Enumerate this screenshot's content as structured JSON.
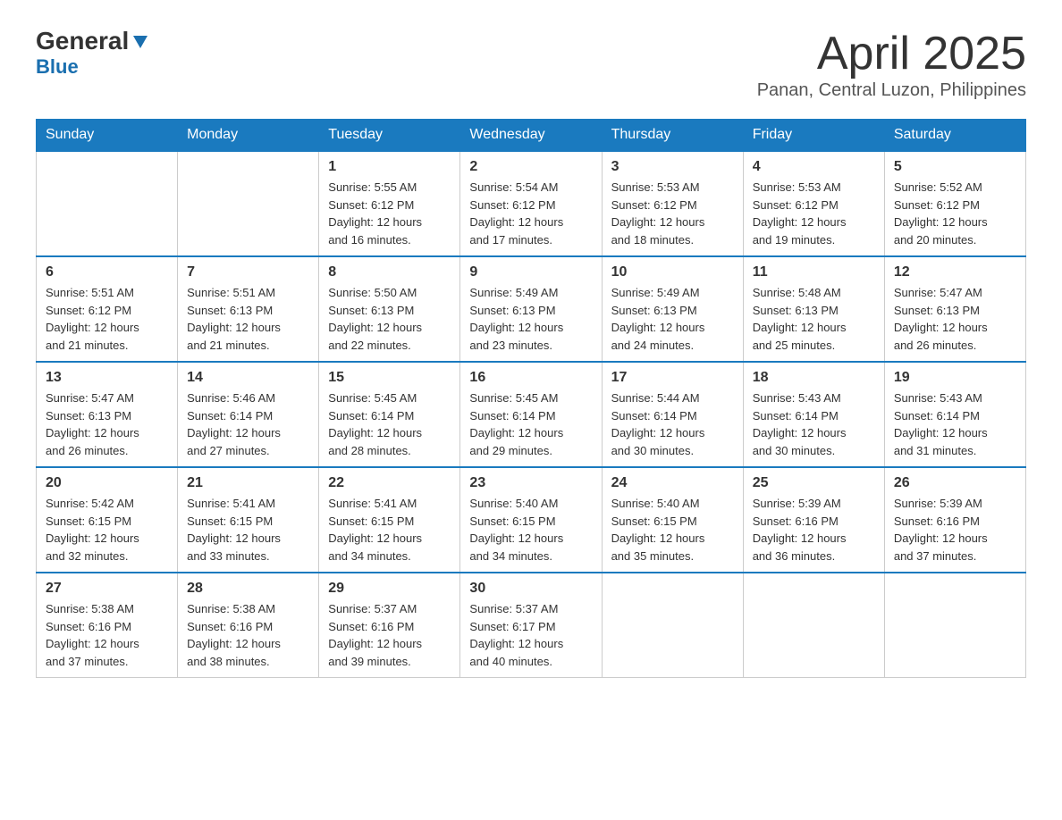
{
  "header": {
    "logo_main": "General",
    "logo_sub": "Blue",
    "month_title": "April 2025",
    "subtitle": "Panan, Central Luzon, Philippines"
  },
  "days_of_week": [
    "Sunday",
    "Monday",
    "Tuesday",
    "Wednesday",
    "Thursday",
    "Friday",
    "Saturday"
  ],
  "weeks": [
    [
      {
        "day": "",
        "info": ""
      },
      {
        "day": "",
        "info": ""
      },
      {
        "day": "1",
        "info": "Sunrise: 5:55 AM\nSunset: 6:12 PM\nDaylight: 12 hours\nand 16 minutes."
      },
      {
        "day": "2",
        "info": "Sunrise: 5:54 AM\nSunset: 6:12 PM\nDaylight: 12 hours\nand 17 minutes."
      },
      {
        "day": "3",
        "info": "Sunrise: 5:53 AM\nSunset: 6:12 PM\nDaylight: 12 hours\nand 18 minutes."
      },
      {
        "day": "4",
        "info": "Sunrise: 5:53 AM\nSunset: 6:12 PM\nDaylight: 12 hours\nand 19 minutes."
      },
      {
        "day": "5",
        "info": "Sunrise: 5:52 AM\nSunset: 6:12 PM\nDaylight: 12 hours\nand 20 minutes."
      }
    ],
    [
      {
        "day": "6",
        "info": "Sunrise: 5:51 AM\nSunset: 6:12 PM\nDaylight: 12 hours\nand 21 minutes."
      },
      {
        "day": "7",
        "info": "Sunrise: 5:51 AM\nSunset: 6:13 PM\nDaylight: 12 hours\nand 21 minutes."
      },
      {
        "day": "8",
        "info": "Sunrise: 5:50 AM\nSunset: 6:13 PM\nDaylight: 12 hours\nand 22 minutes."
      },
      {
        "day": "9",
        "info": "Sunrise: 5:49 AM\nSunset: 6:13 PM\nDaylight: 12 hours\nand 23 minutes."
      },
      {
        "day": "10",
        "info": "Sunrise: 5:49 AM\nSunset: 6:13 PM\nDaylight: 12 hours\nand 24 minutes."
      },
      {
        "day": "11",
        "info": "Sunrise: 5:48 AM\nSunset: 6:13 PM\nDaylight: 12 hours\nand 25 minutes."
      },
      {
        "day": "12",
        "info": "Sunrise: 5:47 AM\nSunset: 6:13 PM\nDaylight: 12 hours\nand 26 minutes."
      }
    ],
    [
      {
        "day": "13",
        "info": "Sunrise: 5:47 AM\nSunset: 6:13 PM\nDaylight: 12 hours\nand 26 minutes."
      },
      {
        "day": "14",
        "info": "Sunrise: 5:46 AM\nSunset: 6:14 PM\nDaylight: 12 hours\nand 27 minutes."
      },
      {
        "day": "15",
        "info": "Sunrise: 5:45 AM\nSunset: 6:14 PM\nDaylight: 12 hours\nand 28 minutes."
      },
      {
        "day": "16",
        "info": "Sunrise: 5:45 AM\nSunset: 6:14 PM\nDaylight: 12 hours\nand 29 minutes."
      },
      {
        "day": "17",
        "info": "Sunrise: 5:44 AM\nSunset: 6:14 PM\nDaylight: 12 hours\nand 30 minutes."
      },
      {
        "day": "18",
        "info": "Sunrise: 5:43 AM\nSunset: 6:14 PM\nDaylight: 12 hours\nand 30 minutes."
      },
      {
        "day": "19",
        "info": "Sunrise: 5:43 AM\nSunset: 6:14 PM\nDaylight: 12 hours\nand 31 minutes."
      }
    ],
    [
      {
        "day": "20",
        "info": "Sunrise: 5:42 AM\nSunset: 6:15 PM\nDaylight: 12 hours\nand 32 minutes."
      },
      {
        "day": "21",
        "info": "Sunrise: 5:41 AM\nSunset: 6:15 PM\nDaylight: 12 hours\nand 33 minutes."
      },
      {
        "day": "22",
        "info": "Sunrise: 5:41 AM\nSunset: 6:15 PM\nDaylight: 12 hours\nand 34 minutes."
      },
      {
        "day": "23",
        "info": "Sunrise: 5:40 AM\nSunset: 6:15 PM\nDaylight: 12 hours\nand 34 minutes."
      },
      {
        "day": "24",
        "info": "Sunrise: 5:40 AM\nSunset: 6:15 PM\nDaylight: 12 hours\nand 35 minutes."
      },
      {
        "day": "25",
        "info": "Sunrise: 5:39 AM\nSunset: 6:16 PM\nDaylight: 12 hours\nand 36 minutes."
      },
      {
        "day": "26",
        "info": "Sunrise: 5:39 AM\nSunset: 6:16 PM\nDaylight: 12 hours\nand 37 minutes."
      }
    ],
    [
      {
        "day": "27",
        "info": "Sunrise: 5:38 AM\nSunset: 6:16 PM\nDaylight: 12 hours\nand 37 minutes."
      },
      {
        "day": "28",
        "info": "Sunrise: 5:38 AM\nSunset: 6:16 PM\nDaylight: 12 hours\nand 38 minutes."
      },
      {
        "day": "29",
        "info": "Sunrise: 5:37 AM\nSunset: 6:16 PM\nDaylight: 12 hours\nand 39 minutes."
      },
      {
        "day": "30",
        "info": "Sunrise: 5:37 AM\nSunset: 6:17 PM\nDaylight: 12 hours\nand 40 minutes."
      },
      {
        "day": "",
        "info": ""
      },
      {
        "day": "",
        "info": ""
      },
      {
        "day": "",
        "info": ""
      }
    ]
  ]
}
